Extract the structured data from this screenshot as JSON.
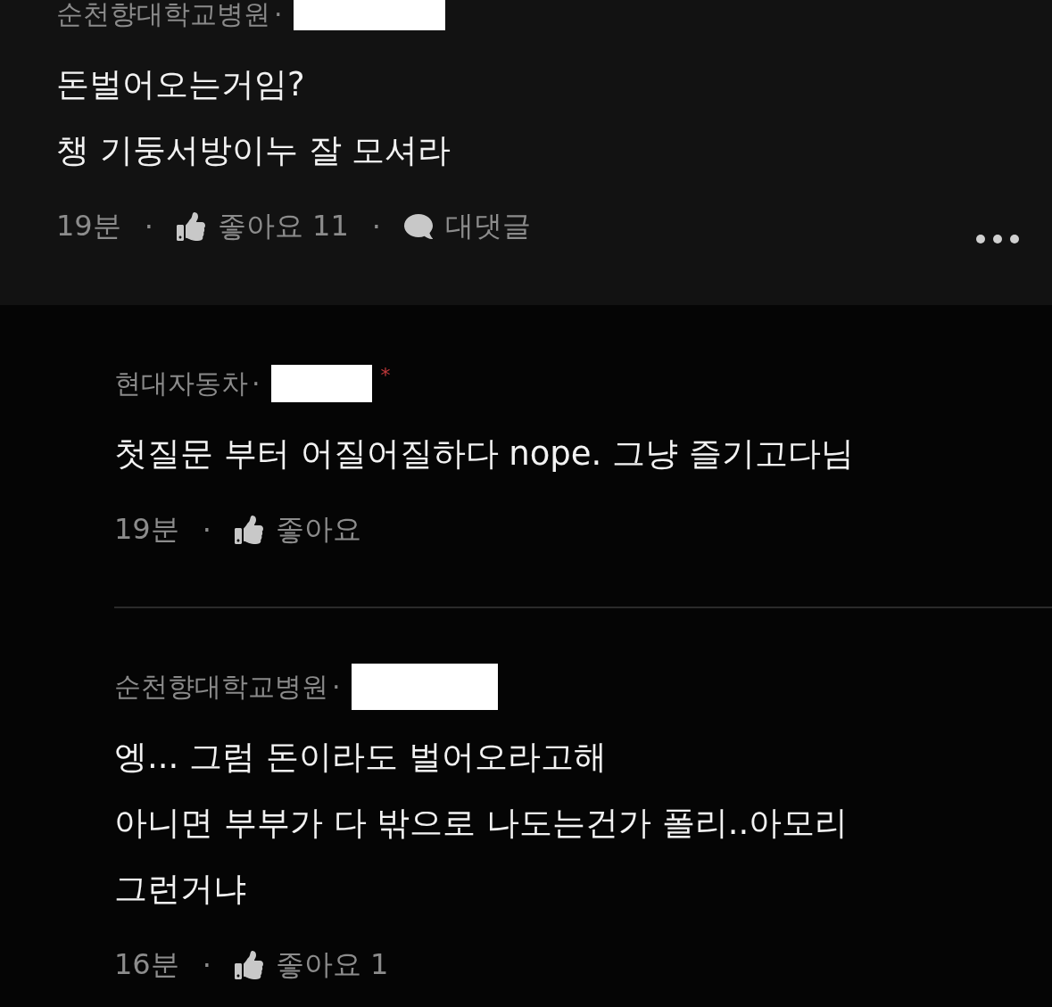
{
  "comments": [
    {
      "author": "순천향대학교병원",
      "name_dot": "·",
      "lines": [
        "돈벌어오는거임?",
        "챙 기둥서방이누 잘 모셔라"
      ],
      "meta": [
        {
          "kind": "time",
          "text": "19분"
        },
        {
          "kind": "dot",
          "text": "·"
        },
        {
          "kind": "like",
          "text": "좋아요 11"
        },
        {
          "kind": "dot",
          "text": "·"
        },
        {
          "kind": "reply",
          "text": "대댓글"
        }
      ],
      "has_more": true
    }
  ],
  "replies": [
    {
      "author": "현대자동차",
      "name_dot": "·",
      "badge": "*",
      "lines": [
        "첫질문 부터 어질어질하다 nope. 그냥 즐기고다님"
      ],
      "meta": [
        {
          "kind": "time",
          "text": "19분"
        },
        {
          "kind": "dot",
          "text": "·"
        },
        {
          "kind": "like",
          "text": "좋아요"
        }
      ]
    },
    {
      "author": "순천향대학교병원",
      "name_dot": "·",
      "lines": [
        "엥... 그럼 돈이라도 벌어오라고해",
        "아니면 부부가 다 밖으로 나도는건가 폴리..아모리",
        "그런거냐"
      ],
      "meta": [
        {
          "kind": "time",
          "text": "16분"
        },
        {
          "kind": "dot",
          "text": "·"
        },
        {
          "kind": "like",
          "text": "좋아요 1"
        }
      ]
    }
  ]
}
